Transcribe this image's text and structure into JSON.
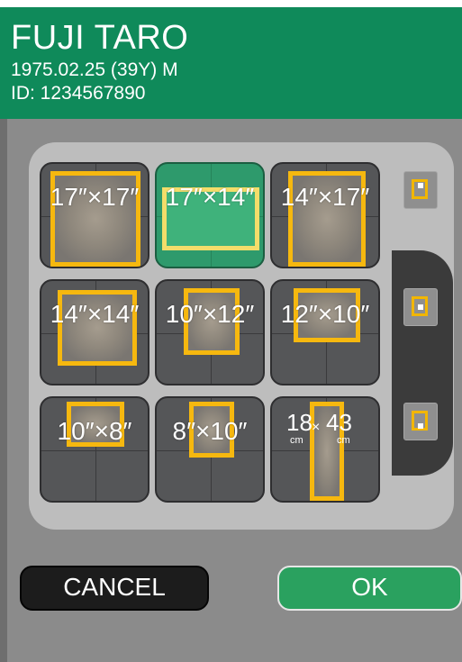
{
  "header": {
    "patient_name": "FUJI TARO",
    "patient_info": "1975.02.25 (39Y) M",
    "patient_id": "ID: 1234567890",
    "bg_color": "#0f8a5a"
  },
  "film_sizes": {
    "tiles": [
      {
        "label": "17″×17″",
        "selected": false
      },
      {
        "label": "17″×14″",
        "selected": true
      },
      {
        "label": "14″×17″",
        "selected": false
      },
      {
        "label": "14″×14″",
        "selected": false
      },
      {
        "label": "10″×12″",
        "selected": false
      },
      {
        "label": "12″×10″",
        "selected": false
      },
      {
        "label": "10″×8″",
        "selected": false
      },
      {
        "label": "8″×10″",
        "selected": false
      },
      {
        "label_a": "18",
        "label_b": "43",
        "unit_a": "cm",
        "unit_b": "cm",
        "times": "×",
        "selected": false
      }
    ],
    "accent_color": "#f6b80f",
    "selected_color": "#2e9a6c"
  },
  "orientation": {
    "options": [
      "top-position-icon",
      "center-position-icon",
      "bottom-position-icon"
    ],
    "selected_index": 0
  },
  "actions": {
    "cancel_label": "CANCEL",
    "ok_label": "OK"
  }
}
